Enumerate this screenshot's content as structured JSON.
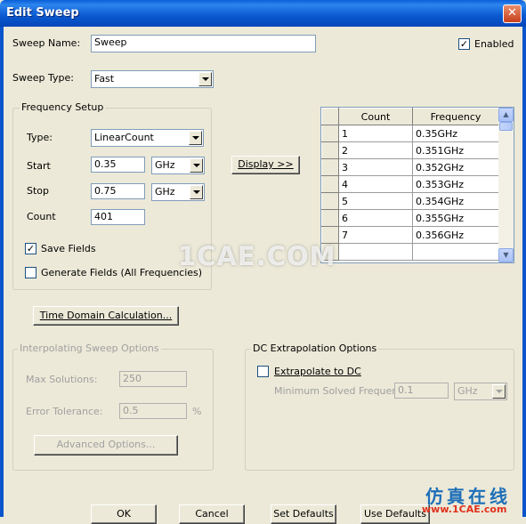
{
  "window": {
    "title": "Edit Sweep",
    "close_glyph": "✕"
  },
  "sweep": {
    "name_label": "Sweep Name:",
    "name_value": "Sweep",
    "enabled_label": "Enabled",
    "enabled_checked": true,
    "type_label": "Sweep Type:",
    "type_value": "Fast"
  },
  "frequency_setup": {
    "title": "Frequency Setup",
    "type_label": "Type:",
    "type_value": "LinearCount",
    "start_label": "Start",
    "start_value": "0.35",
    "start_unit": "GHz",
    "stop_label": "Stop",
    "stop_value": "0.75",
    "stop_unit": "GHz",
    "count_label": "Count",
    "count_value": "401",
    "save_fields_label": "Save Fields",
    "save_fields_checked": true,
    "generate_fields_label": "Generate Fields (All Frequencies)",
    "generate_fields_checked": false
  },
  "display_button": "Display >>",
  "grid": {
    "headers": [
      "Count",
      "Frequency"
    ],
    "rows": [
      [
        "1",
        "0.35GHz"
      ],
      [
        "2",
        "0.351GHz"
      ],
      [
        "3",
        "0.352GHz"
      ],
      [
        "4",
        "0.353GHz"
      ],
      [
        "5",
        "0.354GHz"
      ],
      [
        "6",
        "0.355GHz"
      ],
      [
        "7",
        "0.356GHz"
      ]
    ]
  },
  "time_domain_button": "Time Domain Calculation...",
  "interpolating": {
    "title": "Interpolating Sweep Options",
    "max_solutions_label": "Max Solutions:",
    "max_solutions_value": "250",
    "error_tolerance_label": "Error Tolerance:",
    "error_tolerance_value": "0.5",
    "error_unit": "%",
    "advanced_button": "Advanced Options..."
  },
  "dc_extrapolation": {
    "title": "DC Extrapolation Options",
    "extrapolate_label": "Extrapolate to DC",
    "extrapolate_checked": false,
    "min_freq_label": "Minimum Solved Frequency",
    "min_freq_value": "0.1",
    "min_freq_unit": "GHz"
  },
  "footer_buttons": {
    "ok": "OK",
    "cancel": "Cancel",
    "set_defaults": "Set Defaults",
    "use_defaults": "Use Defaults"
  },
  "watermark": {
    "text": "1CAE.COM",
    "logo_cn": "仿真在线",
    "logo_url": "www.1CAE.com"
  },
  "colors": {
    "titlebar": "#0a58d0",
    "dialog_bg": "#ece9d8",
    "close_button": "#c8401c"
  }
}
